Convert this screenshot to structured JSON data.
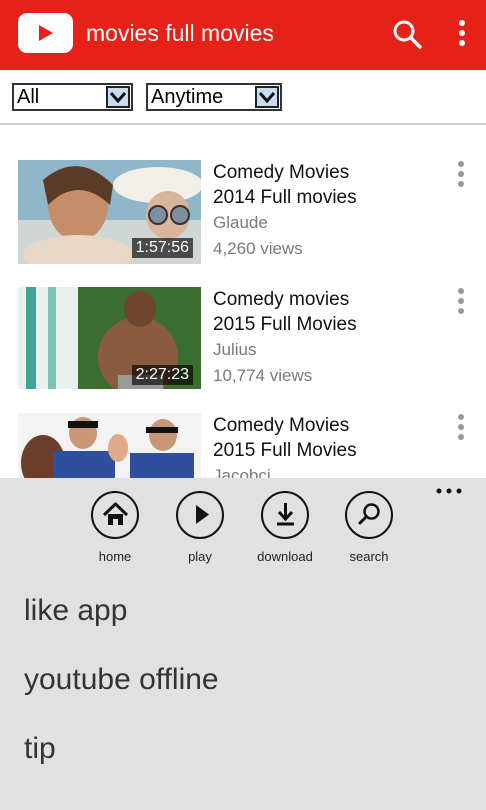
{
  "header": {
    "title": "movies full movies",
    "logo_icon": "play-logo-icon",
    "search_icon": "search-icon",
    "more_icon": "more-vertical-icon",
    "bg_color": "#e62117"
  },
  "filters": {
    "type_value": "All",
    "time_value": "Anytime"
  },
  "videos": [
    {
      "title_line1": "Comedy Movies",
      "title_line2": "2014 Full movies",
      "channel": "Glaude",
      "views": "4,260 views",
      "duration": "1:57:56"
    },
    {
      "title_line1": "Comedy movies",
      "title_line2": "2015 Full Movies",
      "channel": "Julius",
      "views": "10,774 views",
      "duration": "2:27:23"
    },
    {
      "title_line1": "Comedy Movies",
      "title_line2": "2015 Full Movies",
      "channel": "Jacobci",
      "views": "",
      "duration": ""
    }
  ],
  "appbar": {
    "buttons": [
      {
        "label": "home",
        "icon": "home-icon"
      },
      {
        "label": "play",
        "icon": "play-icon"
      },
      {
        "label": "download",
        "icon": "download-icon"
      },
      {
        "label": "search",
        "icon": "search-icon"
      }
    ],
    "menu": [
      "like app",
      "youtube offline",
      "tip"
    ]
  }
}
